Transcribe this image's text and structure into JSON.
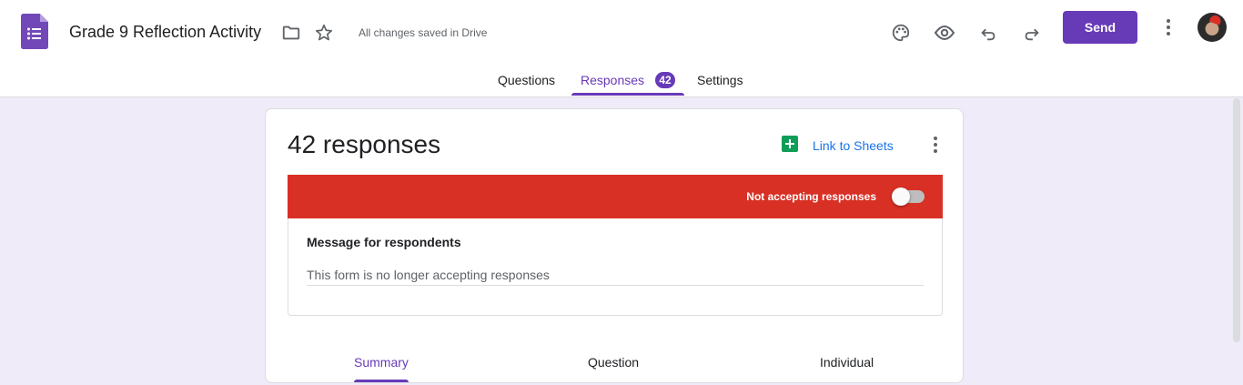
{
  "header": {
    "doc_title": "Grade 9 Reflection Activity",
    "saved_status": "All changes saved in Drive",
    "send_label": "Send",
    "icons": [
      "forms-logo-icon",
      "folder-icon",
      "star-icon",
      "palette-icon",
      "eye-icon",
      "undo-icon",
      "redo-icon",
      "more-vert-icon",
      "avatar"
    ]
  },
  "tabs": {
    "questions": "Questions",
    "responses": "Responses",
    "responses_count": "42",
    "settings": "Settings",
    "active": "responses"
  },
  "card": {
    "response_count_label": "42 responses",
    "link_sheets_label": "Link to Sheets",
    "accepting_label": "Not accepting responses",
    "accepting_on": false,
    "message_label": "Message for respondents",
    "message_value": "This form is no longer accepting responses"
  },
  "sub_tabs": {
    "summary": "Summary",
    "question": "Question",
    "individual": "Individual",
    "active": "summary"
  },
  "colors": {
    "accent": "#673ab7",
    "background": "#f0ebf8",
    "banner_red": "#d93025",
    "link_blue": "#1a73e8",
    "sheets_green": "#0f9d58"
  }
}
